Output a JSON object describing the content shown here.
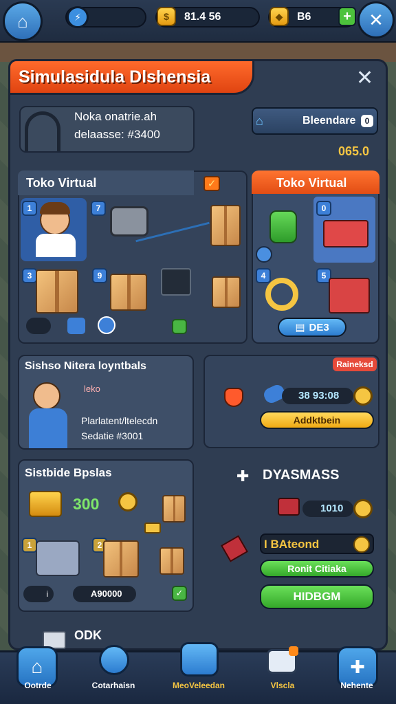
{
  "topbar": {
    "coins": "81.4 56",
    "gems": "B6",
    "plus": "+",
    "close": "✕"
  },
  "panel": {
    "title": "Simulasidula Dlshensia",
    "profile_line1": "Noka onatrie.ah",
    "profile_line2": "delaasse: #3400",
    "balance_button": "Bleendare",
    "balance_badge": "0",
    "balance_value": "065.0"
  },
  "toko_left": {
    "title": "Toko Virtual",
    "badges": [
      "1",
      "7",
      "3",
      "9"
    ]
  },
  "toko_right": {
    "title": "Toko Virtual",
    "badges": [
      "0",
      "4",
      "5"
    ],
    "button": "DE3"
  },
  "seller": {
    "title": "Sishso Nitera loyntbals",
    "tag": "leko",
    "line1": "Plarlatent/ltelecdn",
    "line2": "Sedatie #3001"
  },
  "stats": {
    "badge": "Raineksd",
    "value": "38 93:08",
    "bar": "Addktbein"
  },
  "storage": {
    "title": "Sistbide Bpslas",
    "value": "300",
    "badges": [
      "1",
      "2"
    ],
    "counter": "A90000",
    "icon_label": "i"
  },
  "side": {
    "heading": "DYASMASS",
    "value": "1010",
    "action_label": "I BAteond",
    "btn_green": "Ronit Citiaka",
    "btn_main": "HIDBGM"
  },
  "footer_label": "ODK",
  "nav": [
    "Ootrde",
    "Cotarhaisn",
    "MeoVeleedan",
    "Vlscla",
    "Nehente"
  ],
  "colors": {
    "accent": "#e8511a",
    "gold": "#f5c542",
    "green": "#4cc23c"
  }
}
